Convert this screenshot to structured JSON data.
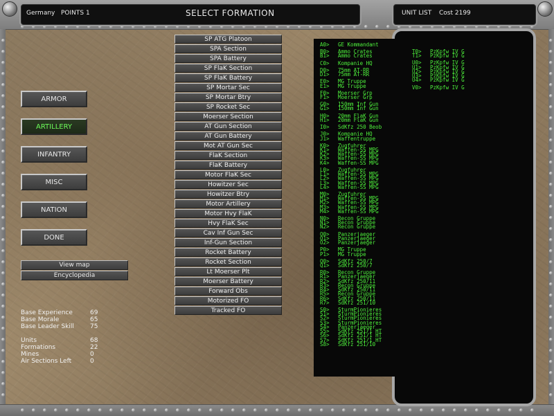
{
  "header": {
    "nation": "Germany",
    "points_label": "POINTS 1",
    "title": "SELECT FORMATION",
    "unit_list_label": "UNIT LIST",
    "cost_label": "Cost 2199"
  },
  "categories": [
    {
      "label": "ARMOR",
      "active": false
    },
    {
      "label": "ARTILLERY",
      "active": true
    },
    {
      "label": "INFANTRY",
      "active": false
    },
    {
      "label": "MISC",
      "active": false
    },
    {
      "label": "NATION",
      "active": false
    },
    {
      "label": "DONE",
      "active": false
    }
  ],
  "actions": {
    "view_map": "View map",
    "encyclopedia": "Encyclopedia"
  },
  "stats": [
    {
      "label": "Base Experience",
      "value": "69"
    },
    {
      "label": "Base Morale",
      "value": "65"
    },
    {
      "label": "Base Leader Skill",
      "value": "75"
    },
    {
      "label": "Units",
      "value": "68"
    },
    {
      "label": "Formations",
      "value": "22"
    },
    {
      "label": "Mines",
      "value": "0"
    },
    {
      "label": "Air Sections Left",
      "value": "0"
    }
  ],
  "formations": [
    "SP ATG Platoon",
    "SPA Section",
    "SPA Battery",
    "SP FlaK Section",
    "SP FlaK Battery",
    "SP Mortar Sec",
    "SP Mortar Btry",
    "SP Rocket Sec",
    "Moerser Section",
    "AT Gun Section",
    "AT Gun Battery",
    "Mot AT Gun Sec",
    "FlaK Section",
    "FlaK Battery",
    "Motor FlaK Sec",
    "Howitzer Sec",
    "Howitzer Btry",
    "Motor Artillery",
    "Motor Hvy FlaK",
    "Hvy FlaK Sec",
    "Cav Inf Gun Sec",
    "Inf-Gun Section",
    "Rocket Battery",
    "Rocket Section",
    "Lt Moerser Plt",
    "Moerser Battery",
    "Forward Obs",
    "Motorized FO",
    "Tracked FO"
  ],
  "unit_list_left": [
    {
      "code": "A0>",
      "name": "GE Kommandant"
    },
    {
      "code": "B0>",
      "name": "Ammo Crates"
    },
    {
      "code": "B1>",
      "name": "Ammo Crates"
    },
    {
      "code": "C0>",
      "name": "Kompanie HQ"
    },
    {
      "code": "D0>",
      "name": "75mm AT-RR"
    },
    {
      "code": "D1>",
      "name": "75mm AT-RR"
    },
    {
      "code": "E0>",
      "name": "MG Truppe"
    },
    {
      "code": "E1>",
      "name": "MG Truppe"
    },
    {
      "code": "F0>",
      "name": "Moerser Grp"
    },
    {
      "code": "F1>",
      "name": "Moerser Grp"
    },
    {
      "code": "G0>",
      "name": "150mm Inf Gun"
    },
    {
      "code": "G1>",
      "name": "150mm Inf Gun"
    },
    {
      "code": "H0>",
      "name": "20mm FlaK Gun"
    },
    {
      "code": "H1>",
      "name": "20mm FlaK Gun"
    },
    {
      "code": "I0>",
      "name": "SdKfz 250 Beob"
    },
    {
      "code": "J0>",
      "name": "Kompanie HQ"
    },
    {
      "code": "J1>",
      "name": "Waffentruppe"
    },
    {
      "code": "K0>",
      "name": "Zugfuhrer"
    },
    {
      "code": "K1>",
      "name": "Waffen-SS MPG"
    },
    {
      "code": "K2>",
      "name": "Waffen-SS MPG"
    },
    {
      "code": "K3>",
      "name": "Waffen-SS MPG"
    },
    {
      "code": "K4>",
      "name": "Waffen-SS MPG"
    },
    {
      "code": "L0>",
      "name": "Zugfuhrer"
    },
    {
      "code": "L1>",
      "name": "Waffen-SS MPG"
    },
    {
      "code": "L2>",
      "name": "Waffen-SS MPG"
    },
    {
      "code": "L3>",
      "name": "Waffen-SS MPG"
    },
    {
      "code": "L4>",
      "name": "Waffen-SS MPG"
    },
    {
      "code": "M0>",
      "name": "Zugfuhrer"
    },
    {
      "code": "M1>",
      "name": "Waffen-SS MPG"
    },
    {
      "code": "M2>",
      "name": "Waffen-SS MPG"
    },
    {
      "code": "M3>",
      "name": "Waffen-SS MPG"
    },
    {
      "code": "M4>",
      "name": "Waffen-SS MPG"
    },
    {
      "code": "N0>",
      "name": "Recon Gruppe"
    },
    {
      "code": "N1>",
      "name": "Recon Gruppe"
    },
    {
      "code": "N2>",
      "name": "Recon Gruppe"
    },
    {
      "code": "O0>",
      "name": "Panzerjaeger"
    },
    {
      "code": "O1>",
      "name": "Panzerjaeger"
    },
    {
      "code": "O2>",
      "name": "Panzerjaeger"
    },
    {
      "code": "P0>",
      "name": "MG Truppe"
    },
    {
      "code": "P1>",
      "name": "MG Truppe"
    },
    {
      "code": "Q0>",
      "name": "SdKfz 250/7"
    },
    {
      "code": "Q1>",
      "name": "SdKfz 250/7"
    },
    {
      "code": "R0>",
      "name": "Recon Gruppe"
    },
    {
      "code": "R1>",
      "name": "Panzerjaeger"
    },
    {
      "code": "R2>",
      "name": "SdKfz 250/11"
    },
    {
      "code": "R3>",
      "name": "Recon Gruppe"
    },
    {
      "code": "R4>",
      "name": "SdKfz 250/11"
    },
    {
      "code": "R5>",
      "name": "Recon Gruppe"
    },
    {
      "code": "R6>",
      "name": "SdKfz 250/11"
    },
    {
      "code": "R7>",
      "name": "SdKfz 251/10"
    },
    {
      "code": "S0>",
      "name": "SturmPionieres"
    },
    {
      "code": "S1>",
      "name": "SturmPionieres"
    },
    {
      "code": "S2>",
      "name": "SturmPionieres"
    },
    {
      "code": "S3>",
      "name": "SturmPionieres"
    },
    {
      "code": "S4>",
      "name": "Panzerjaeger"
    },
    {
      "code": "S5>",
      "name": "SdKfz 251/1 HT"
    },
    {
      "code": "S6>",
      "name": "SdKfz 251/1 HT"
    },
    {
      "code": "S7>",
      "name": "SdKfz 251/1 HT"
    },
    {
      "code": "S8>",
      "name": "SdKfz 251/10"
    }
  ],
  "unit_list_right": [
    {
      "code": "T0>",
      "name": "PzKpfw IV G"
    },
    {
      "code": "T1>",
      "name": "PzKpfw IV G"
    },
    {
      "code": "U0>",
      "name": "PzKpfw IV G"
    },
    {
      "code": "U1>",
      "name": "PzKpfw IV G"
    },
    {
      "code": "U2>",
      "name": "PzKpfw IV G"
    },
    {
      "code": "U3>",
      "name": "PzKpfw IV G"
    },
    {
      "code": "U4>",
      "name": "PzKpfw IV G"
    },
    {
      "code": "V0>",
      "name": "PzKpfw IV G"
    }
  ]
}
